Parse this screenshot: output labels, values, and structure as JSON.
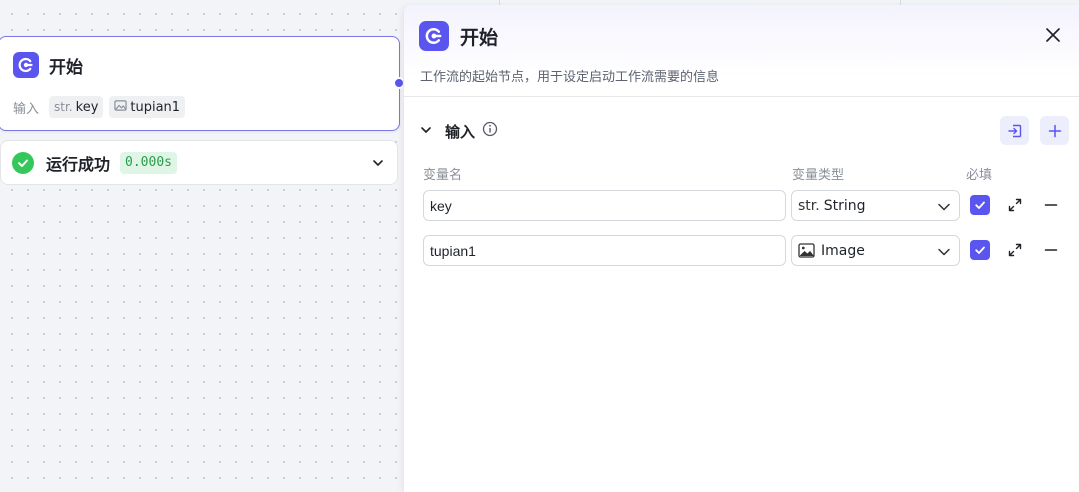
{
  "start_node": {
    "title": "开始",
    "inputs_label": "输入",
    "chips": [
      {
        "type": "str.",
        "name": "key",
        "icon": "string-icon"
      },
      {
        "type": "",
        "name": "tupian1",
        "icon": "image-icon"
      }
    ]
  },
  "run_status": {
    "label": "运行成功",
    "duration": "0.000s"
  },
  "panel": {
    "title": "开始",
    "description": "工作流的起始节点，用于设定启动工作流需要的信息",
    "section_title": "输入",
    "columns": {
      "name": "变量名",
      "type": "变量类型",
      "required": "必填"
    },
    "variables": [
      {
        "name": "key",
        "type_prefix": "str.",
        "type": "String",
        "type_icon": "string-icon",
        "required": true
      },
      {
        "name": "tupian1",
        "type_prefix": "",
        "type": "Image",
        "type_icon": "image-icon",
        "required": true
      }
    ]
  },
  "colors": {
    "accent": "#5b55f0",
    "success": "#34c759",
    "success_bg": "#dff5e5",
    "canvas_bg": "#f2f4f7"
  }
}
